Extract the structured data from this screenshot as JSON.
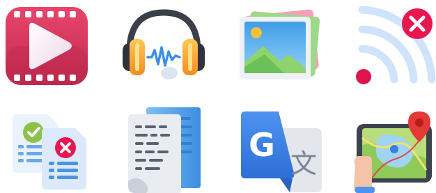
{
  "icons": [
    {
      "id": "video-play",
      "color": "#d6335a"
    },
    {
      "id": "headphones-audio",
      "color": "#f5a623"
    },
    {
      "id": "image-gallery",
      "color": "#5fb0e6"
    },
    {
      "id": "wifi-off",
      "color": "#e8174f"
    },
    {
      "id": "document-approved-rejected",
      "color": "#8bc34a"
    },
    {
      "id": "paper-document",
      "color": "#4a90e2"
    },
    {
      "id": "google-translate",
      "color": "#3b7fe4",
      "glyphs": {
        "latin": "G",
        "cjk": "文"
      }
    },
    {
      "id": "tablet-map-location",
      "color": "#e53935"
    }
  ],
  "palette": {
    "film": "#d6335a",
    "sky": "#5fb0e6",
    "hill": "#8fd36c",
    "sun": "#f7c13a",
    "alert": "#e8174f",
    "check": "#8bc34a",
    "doc_blue": "#4a90e2",
    "grey": "#dfe4ea"
  }
}
